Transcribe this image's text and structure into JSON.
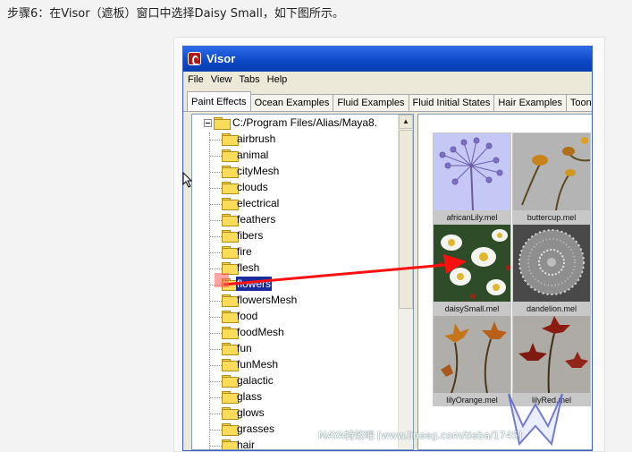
{
  "instruction": "步骤6：在Visor（遮板）窗口中选择Daisy Small，如下图所示。",
  "window": {
    "title": "Visor",
    "menu": [
      "File",
      "View",
      "Tabs",
      "Help"
    ],
    "tabs": [
      "Paint Effects",
      "Ocean Examples",
      "Fluid Examples",
      "Fluid Initial States",
      "Hair Examples",
      "Toon"
    ],
    "active_tab": "Paint Effects"
  },
  "tree": {
    "root_path": "C:/Program Files/Alias/Maya8.",
    "items": [
      "airbrush",
      "animal",
      "cityMesh",
      "clouds",
      "electrical",
      "feathers",
      "fibers",
      "fire",
      "flesh",
      "flowers",
      "flowersMesh",
      "food",
      "foodMesh",
      "fun",
      "funMesh",
      "galactic",
      "glass",
      "glows",
      "grasses",
      "hair"
    ],
    "selected": "flowers"
  },
  "presets": [
    {
      "caption": "africanLily.mel"
    },
    {
      "caption": "buttercup.mel"
    },
    {
      "caption": "daisySmall.mel"
    },
    {
      "caption": "dandelion.mel"
    },
    {
      "caption": "lilyOrange.mel"
    },
    {
      "caption": "lilyRed.mel"
    }
  ],
  "watermark": "MAYA特效吧  [www.lineeg.com/tieba/1745]",
  "colors": {
    "arrow": "#ff1010",
    "title_bar": "#0b47c4",
    "selection": "#1c2c9c"
  }
}
